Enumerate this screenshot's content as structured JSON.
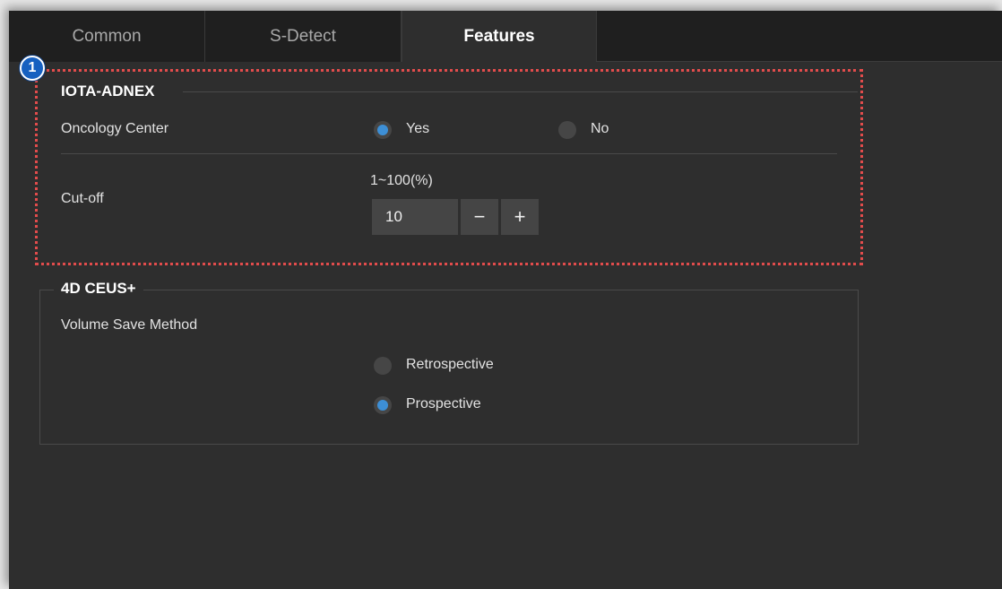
{
  "tabs": [
    {
      "label": "Common",
      "active": false
    },
    {
      "label": "S-Detect",
      "active": false
    },
    {
      "label": "Features",
      "active": true
    }
  ],
  "annotation": {
    "badge": "1"
  },
  "iota_adnex": {
    "title": "IOTA-ADNEX",
    "oncology_center": {
      "label": "Oncology Center",
      "options": [
        {
          "label": "Yes",
          "selected": true
        },
        {
          "label": "No",
          "selected": false
        }
      ]
    },
    "cutoff": {
      "label": "Cut-off",
      "range_label": "1~100(%)",
      "value": "10",
      "minus": "−",
      "plus": "+"
    }
  },
  "ceus": {
    "title": "4D CEUS+",
    "volume_save_method": {
      "label": "Volume Save Method",
      "options": [
        {
          "label": "Retrospective",
          "selected": false
        },
        {
          "label": "Prospective",
          "selected": true
        }
      ]
    }
  },
  "colors": {
    "accent": "#3d8fd6",
    "callout": "#e24c4c",
    "badge": "#1660c0"
  }
}
